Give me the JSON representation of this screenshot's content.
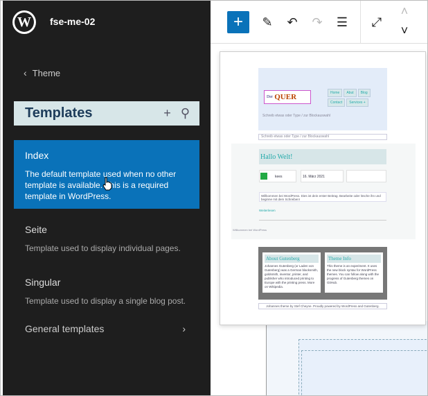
{
  "sidebar": {
    "site_name": "fse-me-02",
    "back_label": "Theme",
    "section_title": "Templates",
    "templates": [
      {
        "title": "Index",
        "description": "The default template used when no other template is available. This is a required template in WordPress.",
        "active": true
      },
      {
        "title": "Seite",
        "description": "Template used to display individual pages."
      },
      {
        "title": "Singular",
        "description": "Template used to display a single blog post."
      }
    ],
    "general_label": "General templates"
  },
  "icons": {
    "wp": "W",
    "back": "‹",
    "add": "+",
    "search": "⚲",
    "chevron_right": "›",
    "pencil": "✎",
    "undo": "↶",
    "redo": "↷",
    "list": "☰",
    "expand": "⤢",
    "up": "˄",
    "down": "˅"
  },
  "preview": {
    "logo_prefix": "Der",
    "logo_main": "QUER",
    "nav": [
      "Home",
      "Abut",
      "Blog",
      "Contact",
      "Services +"
    ],
    "tagline": "Schreib etwas oder Type / zur Blockauswahl",
    "tagline2": "Schreib etwas oder Type / zur Blockauswahl",
    "post_title": "Hallo Welt!",
    "author": "kees",
    "date": "16. März 2021",
    "excerpt": "Willkommen bei WordPress. Dies ist dein erster Beitrag. Bearbeite oder lösche ihn und beginne mit dem Schreiben!",
    "more": "Weiterlesen",
    "left_note": "Willkommen bei WordPress",
    "widget1_title": "About Gutenberg",
    "widget1_text": "Johannes Gutenberg (or Laden von Gutenberg) was a German blacksmith, goldsmith, inventor, printer, and publisher who introduced printing to Europe with the printing press. More on Wikipedia.",
    "widget2_title": "Theme Info",
    "widget2_text": "This theme is an experiment. It uses the new block syntax for WordPress themes. You can follow along with the progress of Gutenberg themes on GitHub.",
    "credit": "Johannes theme by Stef Cheyne. Proudly powered by WordPress and Gutenberg."
  }
}
